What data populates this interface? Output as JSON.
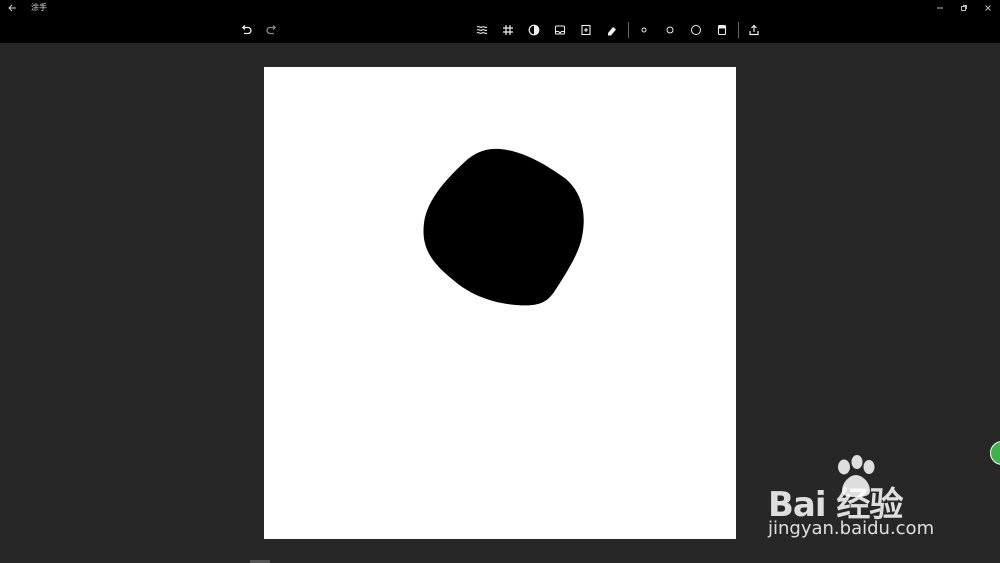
{
  "window": {
    "title": "涂手"
  },
  "toolbar": {
    "left": [
      {
        "id": "undo",
        "icon": "undo-icon"
      },
      {
        "id": "redo",
        "icon": "redo-icon"
      }
    ],
    "center": [
      {
        "id": "lines",
        "icon": "wave-lines-icon"
      },
      {
        "id": "grid",
        "icon": "grid-icon"
      },
      {
        "id": "contrast",
        "icon": "contrast-icon"
      },
      {
        "id": "gallery",
        "icon": "image-tray-icon"
      },
      {
        "id": "new-page",
        "icon": "page-add-icon"
      },
      {
        "id": "eraser",
        "icon": "eraser-icon"
      },
      {
        "id": "brush-small",
        "icon": "brush-small-icon"
      },
      {
        "id": "brush-medium",
        "icon": "brush-medium-icon"
      },
      {
        "id": "brush-large",
        "icon": "brush-large-icon"
      },
      {
        "id": "color",
        "icon": "color-swatch-icon"
      },
      {
        "id": "share",
        "icon": "share-icon"
      }
    ]
  },
  "canvas": {
    "background": "#ffffff",
    "stroke_color": "#000000"
  },
  "colors": {
    "chrome": "#000000",
    "workspace": "#272727",
    "accent_green": "#3bb44a"
  },
  "watermark": {
    "logo": "Bai  经验",
    "url": "jingyan.baidu.com"
  }
}
